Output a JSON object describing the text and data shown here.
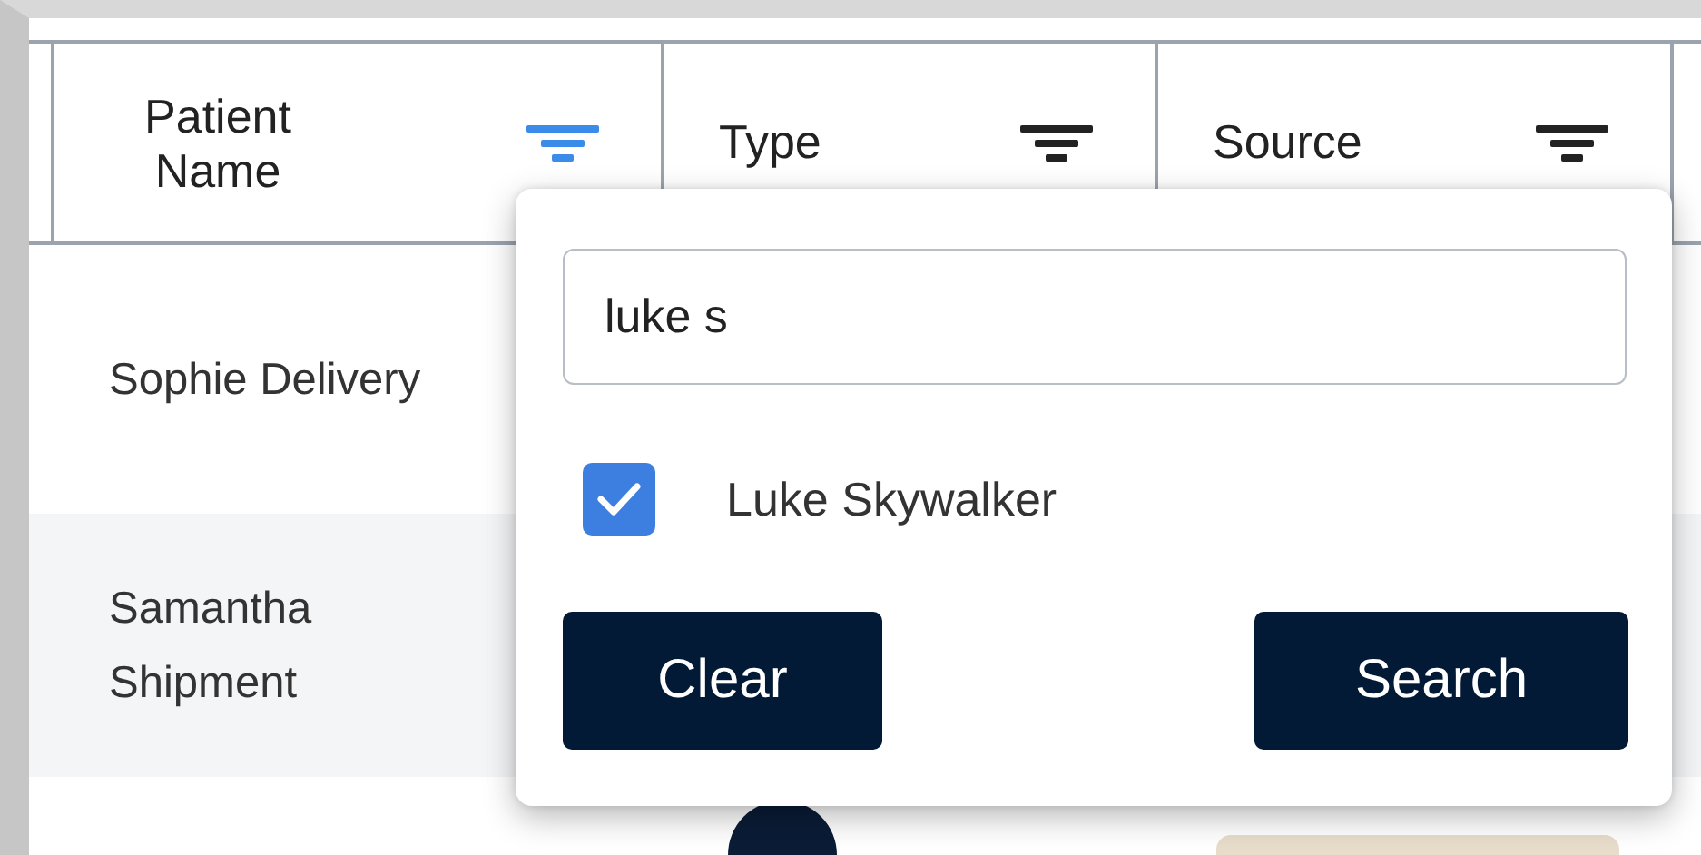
{
  "table": {
    "columns": [
      {
        "label": "Patient Name",
        "filter_active": true
      },
      {
        "label": "Type",
        "filter_active": false
      },
      {
        "label": "Source",
        "filter_active": false
      }
    ],
    "rows": [
      {
        "patient_name": "Sophie Delivery"
      },
      {
        "patient_name": "Samantha Shipment"
      }
    ]
  },
  "filter_popup": {
    "search": {
      "value": "luke s"
    },
    "options": [
      {
        "label": "Luke Skywalker",
        "checked": true
      }
    ],
    "buttons": [
      {
        "label": "Clear"
      },
      {
        "label": "Search"
      }
    ]
  }
}
